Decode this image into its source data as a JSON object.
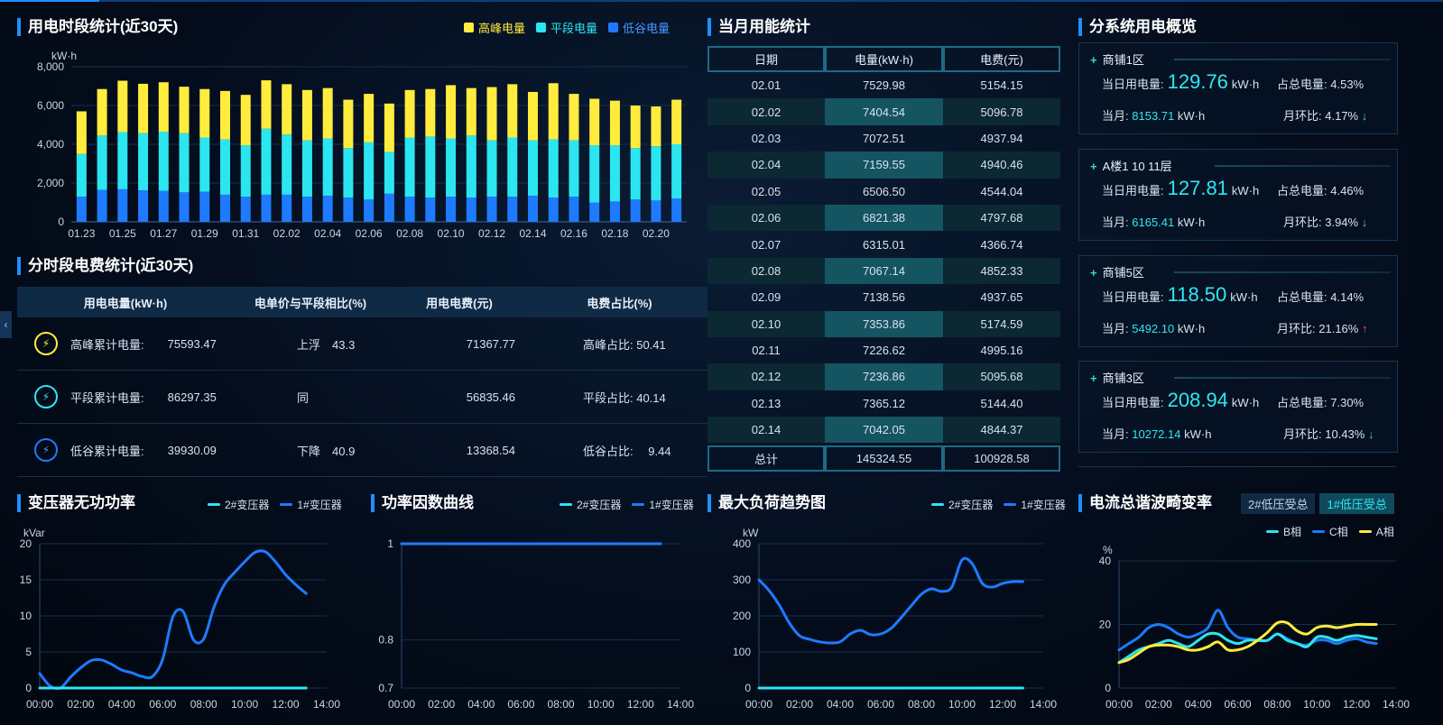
{
  "colors": {
    "peak": "#ffec3d",
    "flat": "#2be6f0",
    "valley": "#1e7bff",
    "line1": "#1e7bff",
    "line2": "#2be6f0",
    "lineA": "#ffec3d"
  },
  "energy": {
    "title": "用电时段统计(近30天)",
    "legend": [
      "高峰电量",
      "平段电量",
      "低谷电量"
    ],
    "ylabel": "kW·h",
    "yticks": [
      "8,000",
      "6,000",
      "4,000",
      "2,000",
      "0"
    ],
    "xticks": [
      "01.23",
      "01.25",
      "01.27",
      "01.29",
      "01.31",
      "02.02",
      "02.04",
      "02.06",
      "02.08",
      "02.10",
      "02.12",
      "02.14",
      "02.16",
      "02.18",
      "02.20"
    ]
  },
  "fee": {
    "title": "分时段电费统计(近30天)",
    "headers": [
      "用电电量(kW·h)",
      "电单价与平段相比(%)",
      "用电电费(元)",
      "电费占比(%)"
    ],
    "rows": [
      {
        "label": "高峰累计电量:",
        "kwh": "75593.47",
        "cmp": "上浮　43.3",
        "cost": "71367.77",
        "share": "高峰占比:  50.41"
      },
      {
        "label": "平段累计电量:",
        "kwh": "86297.35",
        "cmp": "同",
        "cost": "56835.46",
        "share": "平段占比:  40.14"
      },
      {
        "label": "低谷累计电量:",
        "kwh": "39930.09",
        "cmp": "下降　40.9",
        "cost": "13368.54",
        "share": "低谷占比:　 9.44"
      }
    ]
  },
  "month": {
    "title": "当月用能统计",
    "headers": [
      "日期",
      "电量(kW·h)",
      "电费(元)"
    ],
    "rows": [
      [
        "02.01",
        "7529.98",
        "5154.15"
      ],
      [
        "02.02",
        "7404.54",
        "5096.78"
      ],
      [
        "02.03",
        "7072.51",
        "4937.94"
      ],
      [
        "02.04",
        "7159.55",
        "4940.46"
      ],
      [
        "02.05",
        "6506.50",
        "4544.04"
      ],
      [
        "02.06",
        "6821.38",
        "4797.68"
      ],
      [
        "02.07",
        "6315.01",
        "4366.74"
      ],
      [
        "02.08",
        "7067.14",
        "4852.33"
      ],
      [
        "02.09",
        "7138.56",
        "4937.65"
      ],
      [
        "02.10",
        "7353.86",
        "5174.59"
      ],
      [
        "02.11",
        "7226.62",
        "4995.16"
      ],
      [
        "02.12",
        "7236.86",
        "5095.68"
      ],
      [
        "02.13",
        "7365.12",
        "5144.40"
      ],
      [
        "02.14",
        "7042.05",
        "4844.37"
      ]
    ],
    "total": [
      "总计",
      "145324.55",
      "100928.58"
    ]
  },
  "subsys": {
    "title": "分系统用电概览",
    "today_label": "当日用电量:",
    "unit": "kW·h",
    "share_label": "占总电量:",
    "month_label": "当月:",
    "mom_label": "月环比:",
    "cards": [
      {
        "name": "商铺1区",
        "today": "129.76",
        "share": "4.53%",
        "month": "8153.71",
        "mom": "4.17%",
        "dir": "down"
      },
      {
        "name": "A楼1 10 11层",
        "today": "127.81",
        "share": "4.46%",
        "month": "6165.41",
        "mom": "3.94%",
        "dir": "down"
      },
      {
        "name": "商铺5区",
        "today": "118.50",
        "share": "4.14%",
        "month": "5492.10",
        "mom": "21.16%",
        "dir": "up"
      },
      {
        "name": "商铺3区",
        "today": "208.94",
        "share": "7.30%",
        "month": "10272.14",
        "mom": "10.43%",
        "dir": "down"
      }
    ]
  },
  "charts_common": {
    "xticks": [
      "00:00",
      "02:00",
      "04:00",
      "06:00",
      "08:00",
      "10:00",
      "12:00",
      "14:00"
    ],
    "legend2": [
      "2#变压器",
      "1#变压器"
    ]
  },
  "reactive": {
    "title": "变压器无功功率",
    "ylabel": "kVar",
    "yticks": [
      "20",
      "15",
      "10",
      "5",
      "0"
    ]
  },
  "pf": {
    "title": "功率因数曲线",
    "yticks": [
      "1",
      "0.8",
      "0.7"
    ]
  },
  "load": {
    "title": "最大负荷趋势图",
    "ylabel": "kW",
    "yticks": [
      "400",
      "300",
      "200",
      "100",
      "0"
    ]
  },
  "thd": {
    "title": "电流总谐波畸变率",
    "tabs": [
      "2#低压受总",
      "1#低压受总"
    ],
    "ylabel": "%",
    "yticks": [
      "40",
      "20",
      "0"
    ],
    "legend": [
      "B相",
      "C相",
      "A相"
    ]
  },
  "chart_data": [
    {
      "type": "bar",
      "title": "用电时段统计(近30天)",
      "ylabel": "kW·h",
      "ylim": [
        0,
        8000
      ],
      "categories": [
        "01.23",
        "01.24",
        "01.25",
        "01.26",
        "01.27",
        "01.28",
        "01.29",
        "01.30",
        "01.31",
        "02.01",
        "02.02",
        "02.03",
        "02.04",
        "02.05",
        "02.06",
        "02.07",
        "02.08",
        "02.09",
        "02.10",
        "02.11",
        "02.12",
        "02.13",
        "02.14",
        "02.15",
        "02.16",
        "02.17",
        "02.18",
        "02.19",
        "02.20",
        "02.21"
      ],
      "series": [
        {
          "name": "低谷电量",
          "values": [
            1300,
            1650,
            1680,
            1620,
            1600,
            1520,
            1550,
            1400,
            1300,
            1400,
            1400,
            1300,
            1350,
            1250,
            1150,
            1450,
            1300,
            1250,
            1300,
            1250,
            1300,
            1300,
            1350,
            1250,
            1300,
            1000,
            1050,
            1150,
            1100,
            1200
          ]
        },
        {
          "name": "平段电量",
          "values": [
            2200,
            2800,
            2950,
            2950,
            3050,
            3050,
            2800,
            2850,
            2650,
            3400,
            3100,
            2900,
            2950,
            2550,
            2950,
            2150,
            3050,
            3150,
            3000,
            3200,
            2900,
            3050,
            2850,
            3000,
            2900,
            2950,
            2900,
            2650,
            2800,
            2800
          ]
        },
        {
          "name": "高峰电量",
          "values": [
            2200,
            2400,
            2650,
            2550,
            2550,
            2400,
            2500,
            2500,
            2600,
            2500,
            2600,
            2600,
            2600,
            2500,
            2500,
            2500,
            2450,
            2450,
            2750,
            2450,
            2750,
            2750,
            2500,
            2900,
            2400,
            2400,
            2300,
            2200,
            2050,
            2300
          ]
        }
      ]
    },
    {
      "type": "line",
      "title": "变压器无功功率",
      "ylabel": "kVar",
      "ylim": [
        0,
        20
      ],
      "x": [
        0,
        0.5,
        1,
        1.5,
        2,
        2.5,
        3,
        3.5,
        4,
        4.5,
        5,
        5.5,
        6,
        6.5,
        7,
        7.5,
        8,
        8.5,
        9,
        9.5,
        10,
        10.5,
        11,
        11.5,
        12,
        12.5,
        13
      ],
      "series": [
        {
          "name": "1#变压器",
          "values": [
            2,
            0.3,
            0,
            1.5,
            2.8,
            3.8,
            3.9,
            3.3,
            2.5,
            2.1,
            1.6,
            1.6,
            4,
            9.9,
            10.6,
            6.7,
            6.8,
            11.2,
            14.3,
            16,
            17.5,
            18.8,
            18.9,
            17.5,
            15.7,
            14.3,
            13.1
          ]
        },
        {
          "name": "2#变压器",
          "values": [
            0,
            0,
            0,
            0,
            0,
            0,
            0,
            0,
            0,
            0,
            0,
            0,
            0,
            0,
            0,
            0,
            0,
            0,
            0,
            0,
            0,
            0,
            0,
            0,
            0,
            0,
            0
          ]
        }
      ]
    },
    {
      "type": "line",
      "title": "功率因数曲线",
      "ylim": [
        0.7,
        1
      ],
      "x": [
        0,
        13
      ],
      "series": [
        {
          "name": "1#变压器",
          "values": [
            1,
            1
          ]
        },
        {
          "name": "2#变压器",
          "values": [
            1,
            1
          ]
        }
      ]
    },
    {
      "type": "line",
      "title": "最大负荷趋势图",
      "ylabel": "kW",
      "ylim": [
        0,
        400
      ],
      "x": [
        0,
        0.5,
        1,
        1.5,
        2,
        2.5,
        3,
        3.5,
        4,
        4.5,
        5,
        5.5,
        6,
        6.5,
        7,
        7.5,
        8,
        8.5,
        9,
        9.5,
        10,
        10.5,
        11,
        11.5,
        12,
        12.5,
        13
      ],
      "series": [
        {
          "name": "1#变压器",
          "values": [
            300,
            270,
            230,
            180,
            145,
            135,
            128,
            125,
            128,
            150,
            160,
            148,
            150,
            165,
            195,
            228,
            260,
            275,
            268,
            280,
            355,
            345,
            290,
            280,
            290,
            295,
            295
          ]
        },
        {
          "name": "2#变压器",
          "values": [
            0,
            0,
            0,
            0,
            0,
            0,
            0,
            0,
            0,
            0,
            0,
            0,
            0,
            0,
            0,
            0,
            0,
            0,
            0,
            0,
            0,
            0,
            0,
            0,
            0,
            0,
            0
          ]
        }
      ]
    },
    {
      "type": "line",
      "title": "电流总谐波畸变率",
      "ylabel": "%",
      "ylim": [
        0,
        40
      ],
      "x": [
        0,
        0.5,
        1,
        1.5,
        2,
        2.5,
        3,
        3.5,
        4,
        4.5,
        5,
        5.5,
        6,
        6.5,
        7,
        7.5,
        8,
        8.5,
        9,
        9.5,
        10,
        10.5,
        11,
        11.5,
        12,
        12.5,
        13
      ],
      "series": [
        {
          "name": "C相",
          "values": [
            12,
            14,
            16,
            19,
            20,
            19,
            17,
            16,
            17,
            19,
            24.5,
            19,
            16,
            15.5,
            15,
            15,
            17,
            15.5,
            14,
            13.5,
            15,
            15,
            14,
            15,
            15.5,
            14.5,
            14
          ]
        },
        {
          "name": "B相",
          "values": [
            8,
            10,
            12,
            13,
            14,
            15,
            14,
            13,
            15,
            17,
            17,
            15,
            14,
            15,
            15,
            15,
            17,
            15,
            14,
            13,
            16,
            16,
            15,
            16,
            16.5,
            16,
            15.5
          ]
        },
        {
          "name": "A相",
          "values": [
            8,
            9,
            11,
            13,
            13.5,
            13.5,
            13,
            12,
            12,
            13,
            14.5,
            12,
            12,
            13,
            15,
            17.5,
            20.5,
            20.5,
            18,
            17,
            19,
            19.5,
            19,
            19.5,
            20,
            20,
            20
          ]
        }
      ]
    }
  ]
}
